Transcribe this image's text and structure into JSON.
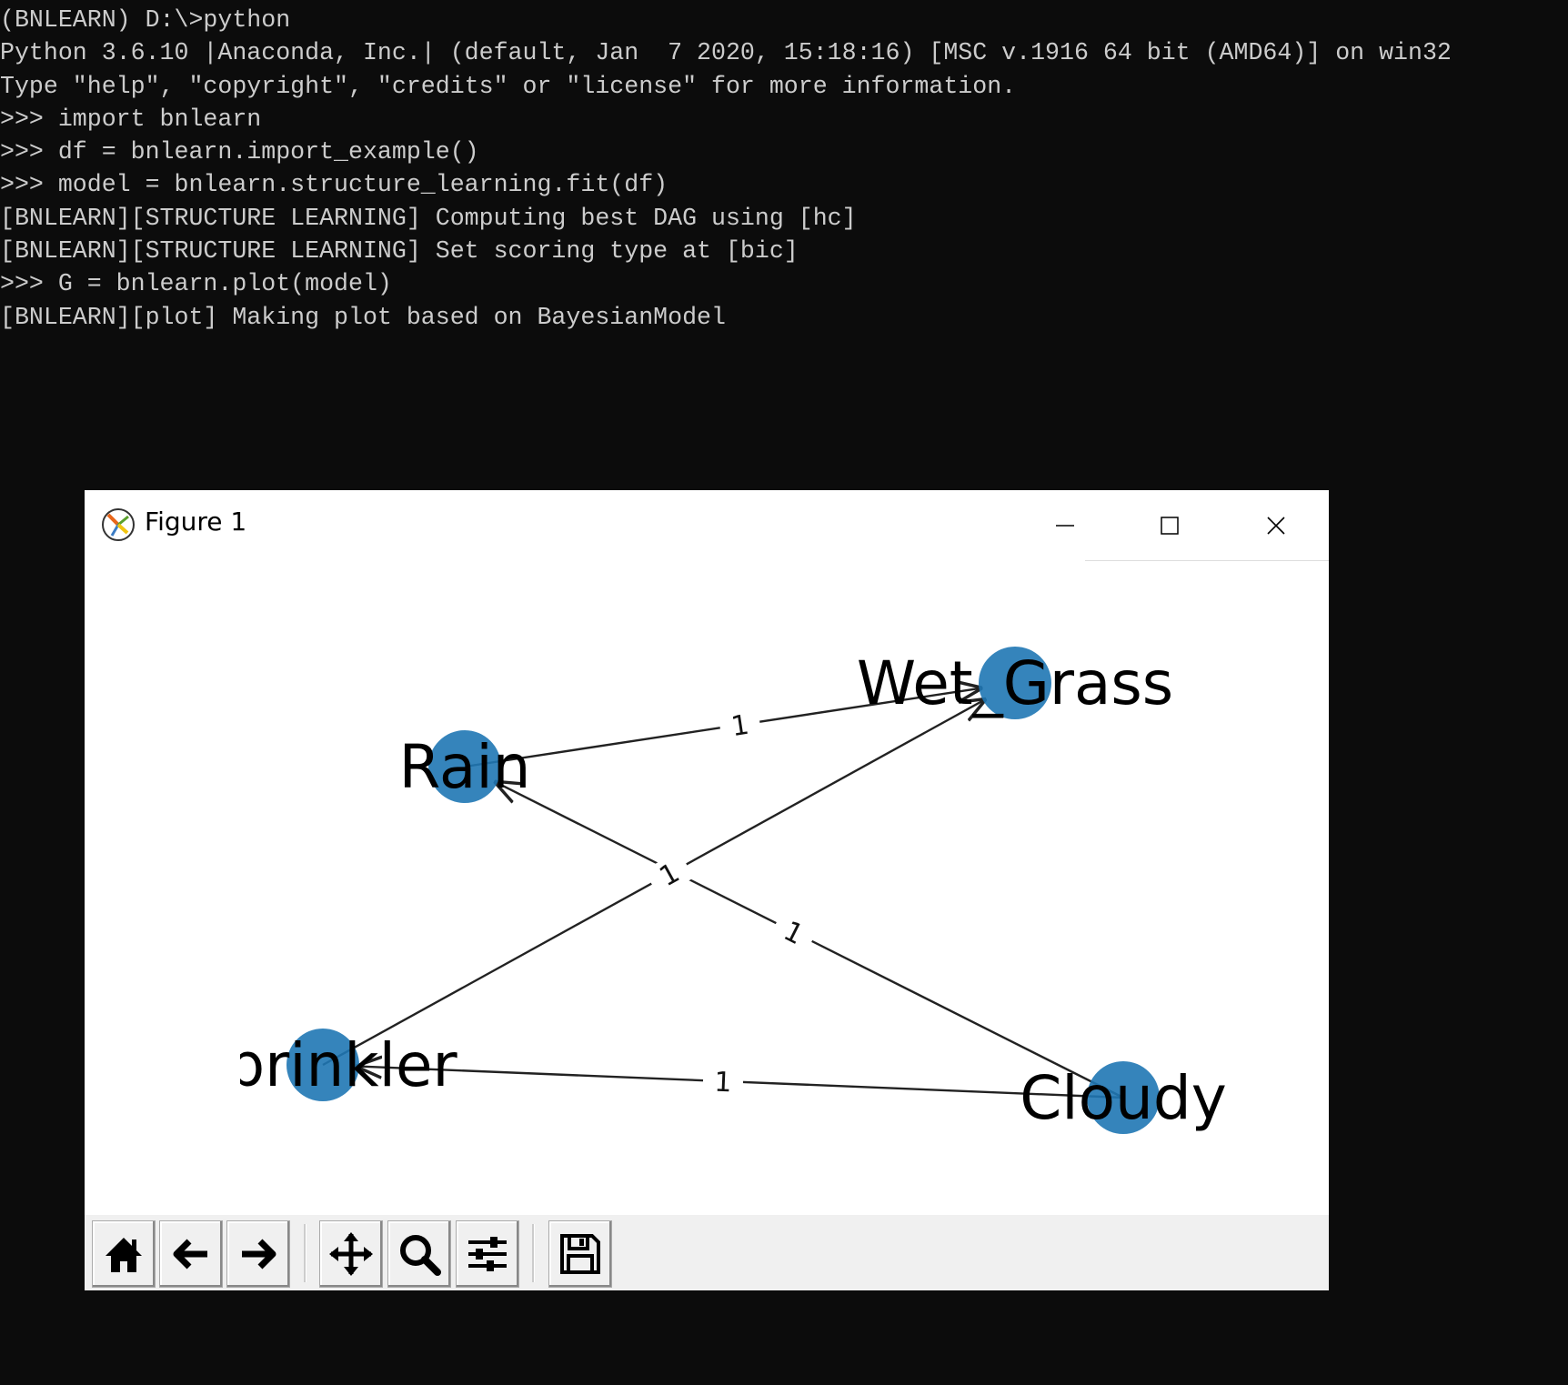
{
  "terminal": {
    "lines": [
      "(BNLEARN) D:\\>python",
      "Python 3.6.10 |Anaconda, Inc.| (default, Jan  7 2020, 15:18:16) [MSC v.1916 64 bit (AMD64)] on win32",
      "Type \"help\", \"copyright\", \"credits\" or \"license\" for more information.",
      ">>> import bnlearn",
      ">>> df = bnlearn.import_example()",
      ">>> model = bnlearn.structure_learning.fit(df)",
      "[BNLEARN][STRUCTURE LEARNING] Computing best DAG using [hc]",
      "[BNLEARN][STRUCTURE LEARNING] Set scoring type at [bic]",
      ">>> G = bnlearn.plot(model)",
      "[BNLEARN][plot] Making plot based on BayesianModel"
    ]
  },
  "figure_window": {
    "title": "Figure 1",
    "icon": "matplotlib-logo-icon",
    "controls": [
      "minimize-icon",
      "maximize-icon",
      "close-icon"
    ]
  },
  "graph": {
    "node_color": "#1f77b4",
    "nodes": [
      {
        "id": "Wet_Grass",
        "label": "Wet_Grass"
      },
      {
        "id": "Rain",
        "label": "Rain"
      },
      {
        "id": "Sprinkler",
        "label": "Sprinkler"
      },
      {
        "id": "Cloudy",
        "label": "Cloudy"
      }
    ],
    "edges": [
      {
        "source": "Rain",
        "target": "Wet_Grass",
        "label": "1"
      },
      {
        "source": "Sprinkler",
        "target": "Wet_Grass",
        "label": "1"
      },
      {
        "source": "Cloudy",
        "target": "Rain",
        "label": "1"
      },
      {
        "source": "Cloudy",
        "target": "Sprinkler",
        "label": "1"
      }
    ]
  },
  "toolbar": {
    "buttons": [
      "home-icon",
      "back-icon",
      "forward-icon",
      "pan-icon",
      "zoom-icon",
      "configure-subplots-icon",
      "save-icon"
    ]
  }
}
